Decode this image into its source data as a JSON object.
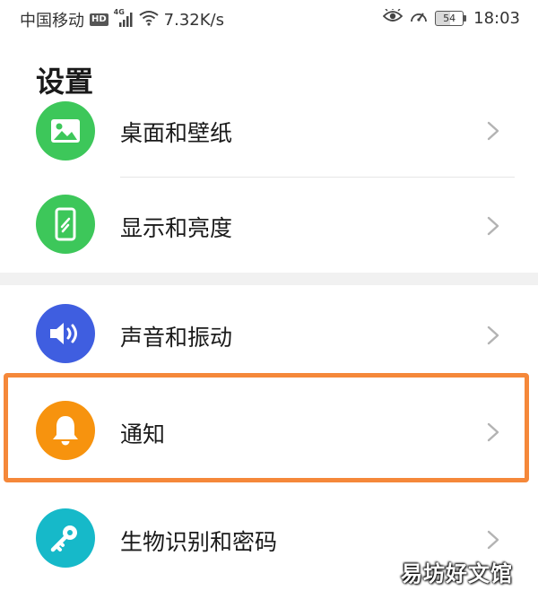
{
  "status_bar": {
    "carrier": "中国移动",
    "hd": "HD",
    "network": "4G",
    "speed": "7.32K/s",
    "battery": "54",
    "time": "18:03"
  },
  "page": {
    "title": "设置"
  },
  "settings": [
    {
      "label": "桌面和壁纸",
      "icon": "wallpaper-icon",
      "color": "#3dc75a"
    },
    {
      "label": "显示和亮度",
      "icon": "phone-brightness-icon",
      "color": "#3dc75a"
    },
    {
      "label": "声音和振动",
      "icon": "speaker-icon",
      "color": "#3f5ee0"
    },
    {
      "label": "通知",
      "icon": "bell-icon",
      "color": "#f7930e"
    },
    {
      "label": "生物识别和密码",
      "icon": "key-icon",
      "color": "#16b9c9"
    }
  ],
  "highlight_color": "#f5883a",
  "watermark": "易坊好文馆"
}
